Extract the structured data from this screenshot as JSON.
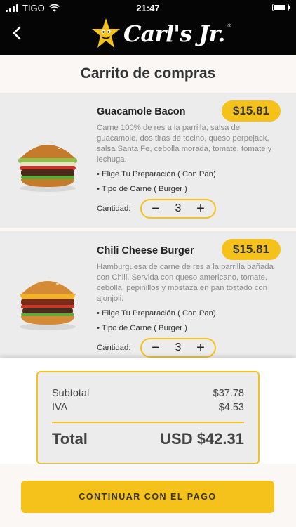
{
  "status_bar": {
    "carrier": "TIGO",
    "time": "21:47"
  },
  "header": {
    "brand": "Carl's Jr.",
    "reg_mark": "®"
  },
  "page": {
    "title": "Carrito de compras"
  },
  "items": [
    {
      "name": "Guacamole Bacon",
      "price": "$15.81",
      "description": "Carne 100% de res a la parrilla, salsa de guacamole, dos tiras de tocino, queso perpejack, salsa Santa Fe, cebolla morada, tomate, tomate y lechuga.",
      "options": [
        "• Elige Tu Preparación ( Con Pan)",
        "• Tipo de Carne ( Burger )"
      ],
      "qty_label": "Cantidad:",
      "quantity": "3",
      "minus": "−",
      "plus": "+"
    },
    {
      "name": "Chili Cheese Burger",
      "price": "$15.81",
      "description": "Hamburguesa de carne de res a la parrilla bañada con Chili. Servida con queso americano, tomate, cebolla, pepinillos y mostaza en pan tostado con ajonjoli.",
      "options": [
        "• Elige Tu Preparación ( Con Pan)",
        "• Tipo de Carne ( Burger )"
      ],
      "qty_label": "Cantidad:",
      "quantity": "3",
      "minus": "−",
      "plus": "+"
    }
  ],
  "summary": {
    "subtotal_label": "Subtotal",
    "subtotal": "$37.78",
    "tax_label": "IVA",
    "tax": "$4.53",
    "total_label": "Total",
    "total": "USD $42.31"
  },
  "cta": {
    "label": "CONTINUAR CON EL PAGO"
  },
  "colors": {
    "accent": "#f4c21b",
    "header_bg": "#050505",
    "card_bg": "#ececec",
    "page_bg": "#fbf7f4"
  }
}
